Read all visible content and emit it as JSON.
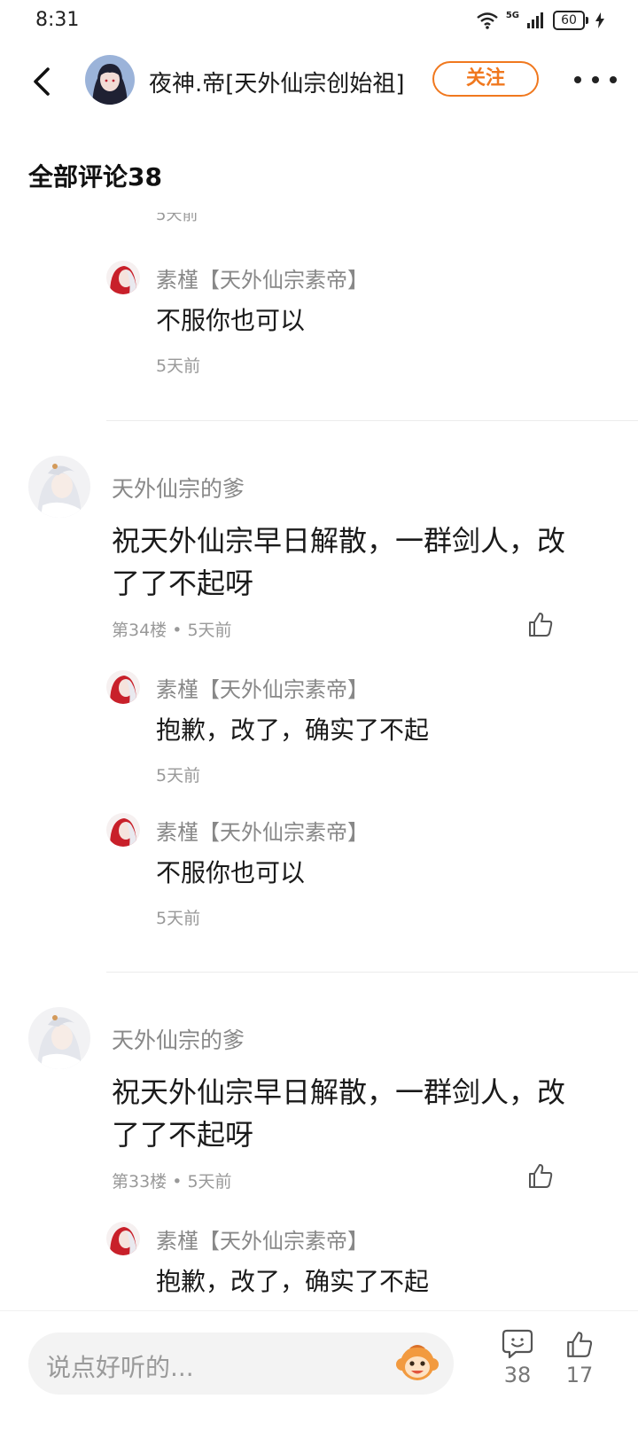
{
  "status": {
    "time": "8:31",
    "network": "5G",
    "battery": "60"
  },
  "header": {
    "username": "夜神.帝[天外仙宗创始祖]",
    "follow_label": "关注"
  },
  "section_title": "全部评论38",
  "partial_time": "5天前",
  "thread1_replies": [
    {
      "user": "素槿【天外仙宗素帝】",
      "text": "不服你也可以",
      "time": "5天前"
    }
  ],
  "comments": [
    {
      "user": "天外仙宗的爹",
      "text": "祝天外仙宗早日解散，一群剑人，改了了不起呀",
      "meta": "第34楼 • 5天前",
      "replies": [
        {
          "user": "素槿【天外仙宗素帝】",
          "text": "抱歉，改了，确实了不起",
          "time": "5天前"
        },
        {
          "user": "素槿【天外仙宗素帝】",
          "text": "不服你也可以",
          "time": "5天前"
        }
      ]
    },
    {
      "user": "天外仙宗的爹",
      "text": "祝天外仙宗早日解散，一群剑人，改了了不起呀",
      "meta": "第33楼 • 5天前",
      "replies": [
        {
          "user": "素槿【天外仙宗素帝】",
          "text": "抱歉，改了，确实了不起",
          "time": ""
        }
      ]
    }
  ],
  "bottom": {
    "placeholder": "说点好听的...",
    "comment_count": "38",
    "like_count": "17"
  },
  "colors": {
    "accent": "#f0781e",
    "muted_text": "#999999",
    "name_text": "#888888"
  }
}
